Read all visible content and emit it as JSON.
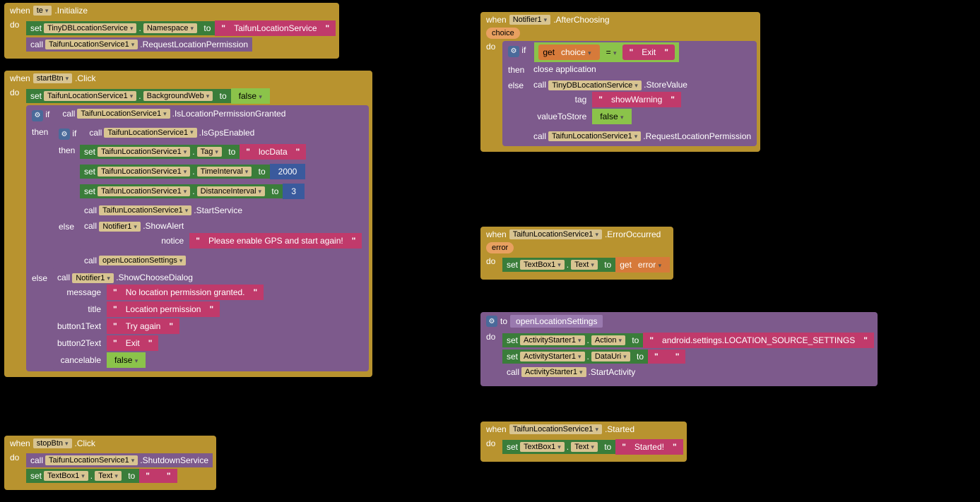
{
  "kw": {
    "when": "when",
    "do": "do",
    "set": "set",
    "call": "call",
    "to": "to",
    "if": "if",
    "then": "then",
    "else": "else",
    "get": "get",
    "eq": "="
  },
  "init": {
    "component": "te",
    "event": ".Initialize",
    "set_target": "TinyDBLocationService",
    "set_prop": "Namespace",
    "set_value": "TaifunLocationService",
    "call_target": "TaifunLocationService1",
    "call_method": ".RequestLocationPermission"
  },
  "start": {
    "component": "startBtn",
    "event": ".Click",
    "set1_target": "TaifunLocationService1",
    "set1_prop": "BackgroundWeb",
    "set1_val": "false",
    "if1_call": "TaifunLocationService1",
    "if1_method": ".IsLocationPermissionGranted",
    "if2_call": "TaifunLocationService1",
    "if2_method": ".IsGpsEnabled",
    "then_rows": {
      "r1_prop": "Tag",
      "r1_val": "locData",
      "r2_prop": "TimeInterval",
      "r2_val": "2000",
      "r3_prop": "DistanceInterval",
      "r3_val": "3",
      "r4_method": ".StartService"
    },
    "else2": {
      "notifier": "Notifier1",
      "method": ".ShowAlert",
      "arg_label": "notice",
      "msg": "Please enable GPS and start again!",
      "call2": "openLocationSettings"
    },
    "else1": {
      "notifier": "Notifier1",
      "method": ".ShowChooseDialog",
      "labels": {
        "message": "message",
        "title": "title",
        "b1": "button1Text",
        "b2": "button2Text",
        "cancel": "cancelable"
      },
      "message": "No location permission granted.",
      "title": "Location permission",
      "b1": "Try again",
      "b2": "Exit",
      "cancel": "false"
    }
  },
  "stop": {
    "component": "stopBtn",
    "event": ".Click",
    "call_target": "TaifunLocationService1",
    "call_method": ".ShutdownService",
    "set_target": "TextBox1",
    "set_prop": "Text",
    "set_val": ""
  },
  "after": {
    "component": "Notifier1",
    "event": ".AfterChoosing",
    "param": "choice",
    "if_var": "choice",
    "if_val": "Exit",
    "then_action": "close application",
    "else_call1_target": "TinyDBLocationService",
    "else_call1_method": ".StoreValue",
    "else_tag_label": "tag",
    "else_tag_val": "showWarning",
    "else_val_label": "valueToStore",
    "else_val_val": "false",
    "else_call2_target": "TaifunLocationService1",
    "else_call2_method": ".RequestLocationPermission"
  },
  "err": {
    "component": "TaifunLocationService1",
    "event": ".ErrorOccurred",
    "param": "error",
    "set_target": "TextBox1",
    "set_prop": "Text",
    "get_var": "error"
  },
  "proc": {
    "name": "openLocationSettings",
    "to_label": "to",
    "r1_target": "ActivityStarter1",
    "r1_prop": "Action",
    "r1_val": "android.settings.LOCATION_SOURCE_SETTINGS",
    "r2_target": "ActivityStarter1",
    "r2_prop": "DataUri",
    "r2_val": "",
    "r3_target": "ActivityStarter1",
    "r3_method": ".StartActivity"
  },
  "started": {
    "component": "TaifunLocationService1",
    "event": ".Started",
    "set_target": "TextBox1",
    "set_prop": "Text",
    "set_val": "Started!"
  }
}
